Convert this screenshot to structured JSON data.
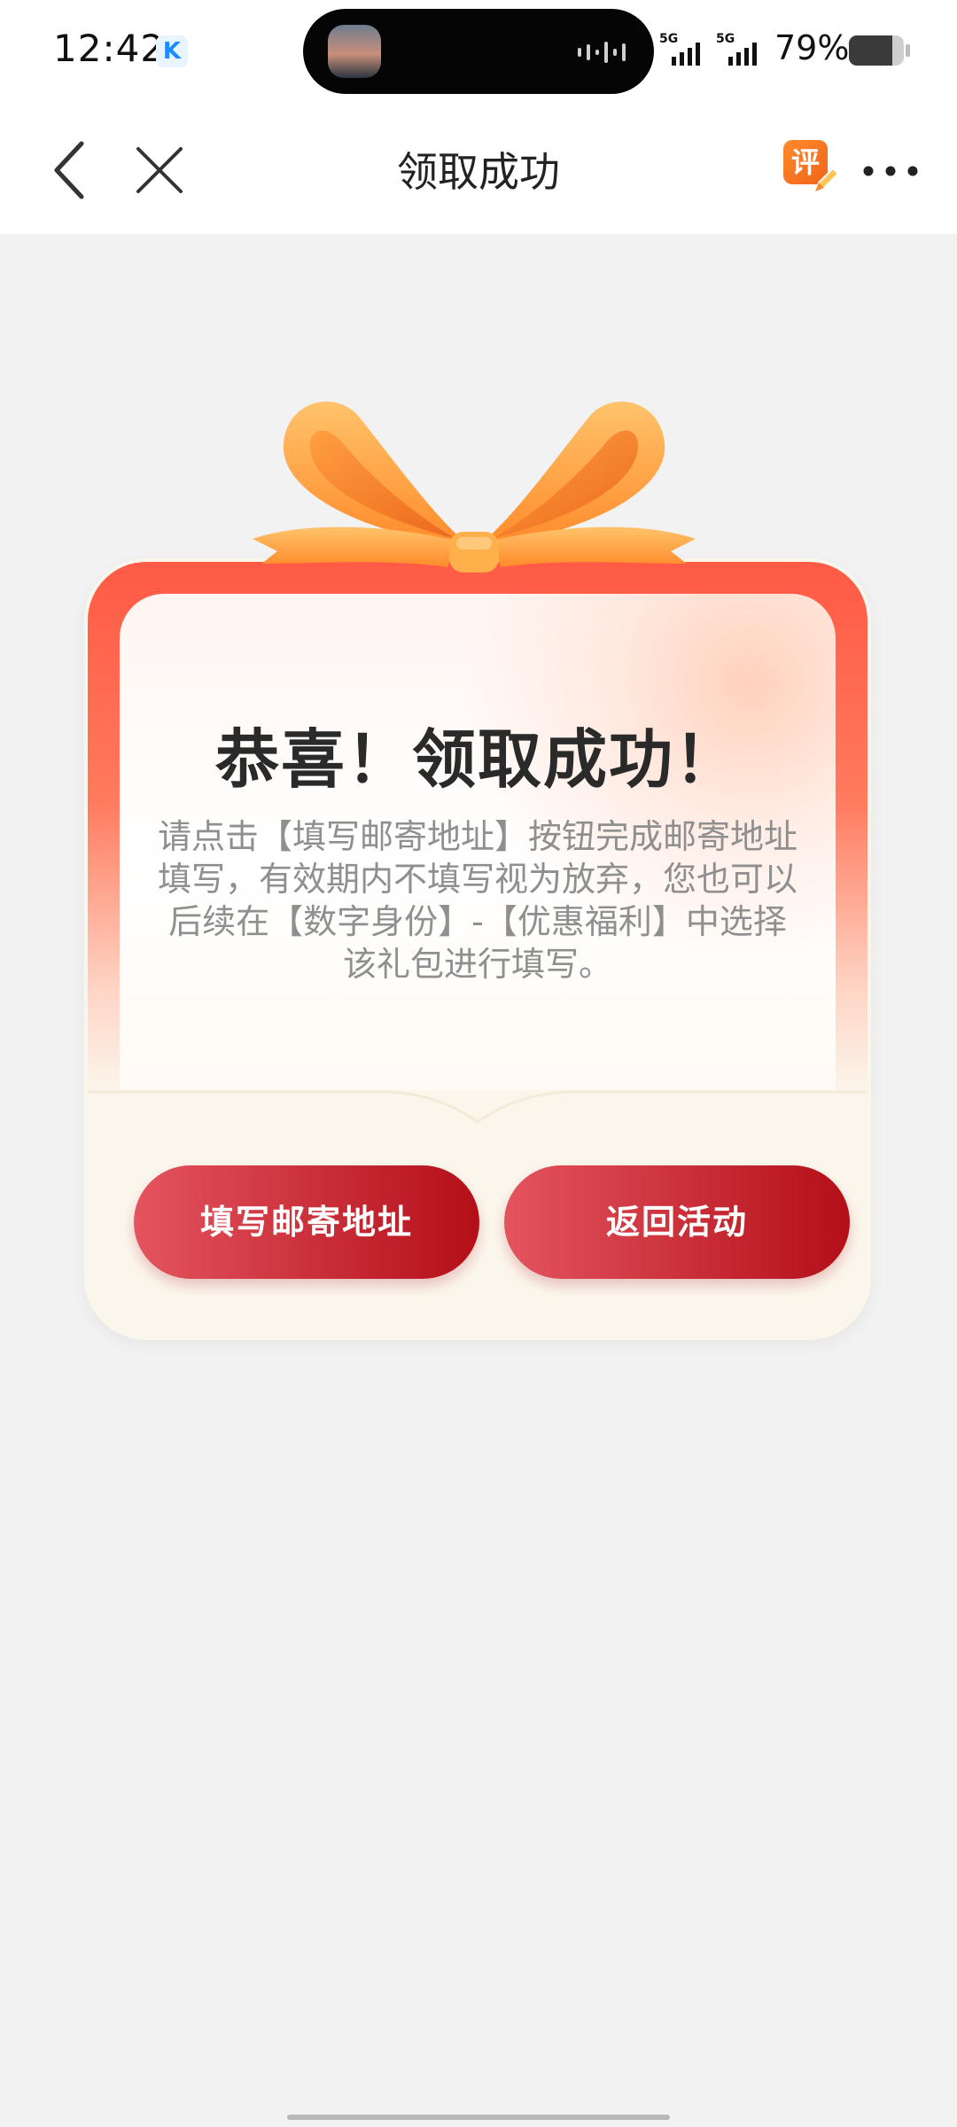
{
  "status_bar": {
    "time": "12:42",
    "app_badge_icon": "kuaishou-k-icon",
    "app_badge_letter": "K",
    "network_1": "5G",
    "network_2": "5G",
    "battery_text": "79%",
    "battery_level": 0.79
  },
  "nav": {
    "back_icon": "chevron-left-icon",
    "close_icon": "close-icon",
    "title": "领取成功",
    "rate_icon_label": "评",
    "more_icon": "more-horizontal-icon"
  },
  "gift_card": {
    "headline": "恭喜！领取成功！",
    "description": "请点击【填写邮寄地址】按钮完成邮寄地址填写，有效期内不填写视为放弃，您也可以后续在【数字身份】-【优惠福利】中选择该礼包进行填写。",
    "buttons": {
      "fill_address": "填写邮寄地址",
      "return_activity": "返回活动"
    }
  },
  "colors": {
    "accent_red": "#b30f18",
    "ribbon_orange": "#ff9a3c",
    "page_background": "#f2f2f2"
  }
}
